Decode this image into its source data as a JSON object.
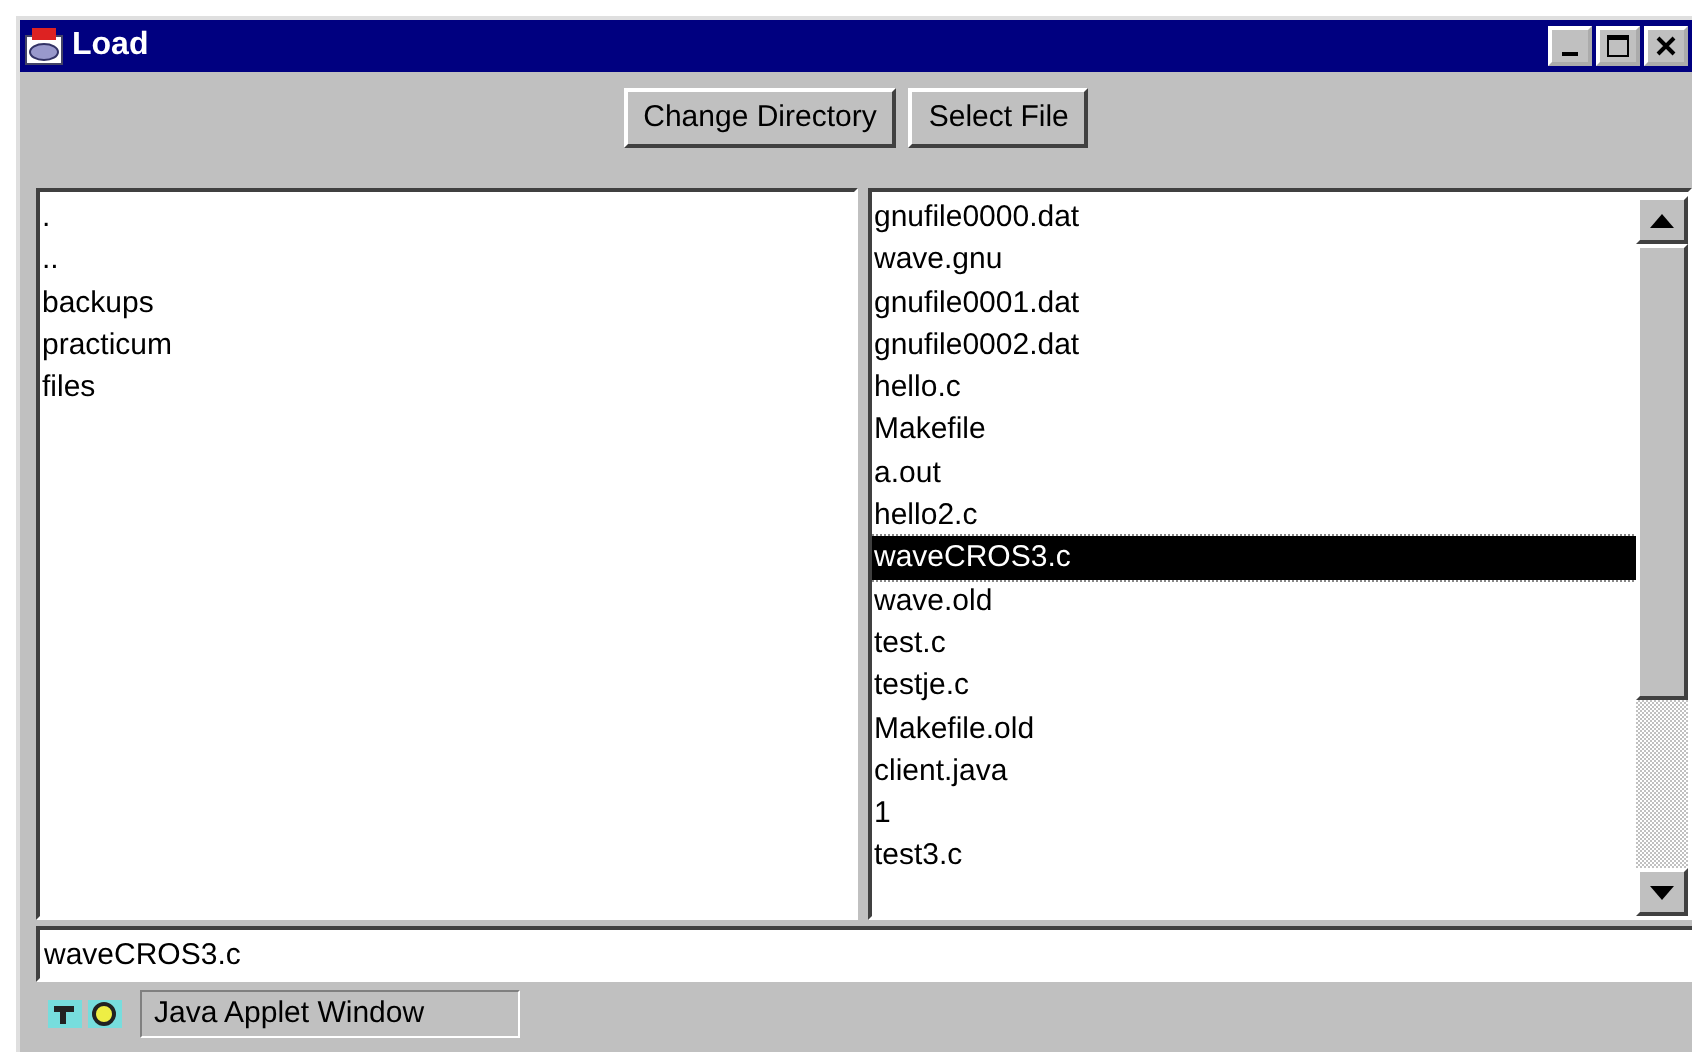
{
  "window": {
    "title": "Load"
  },
  "buttons": [
    "Change Directory",
    "Select File"
  ],
  "directories": [
    {
      "label": ".",
      "selected": false
    },
    {
      "label": "..",
      "selected": false
    },
    {
      "label": "backups",
      "selected": false
    },
    {
      "label": "practicum",
      "selected": false
    },
    {
      "label": "files",
      "selected": false
    }
  ],
  "files": [
    {
      "label": "gnufile0000.dat",
      "selected": false
    },
    {
      "label": "wave.gnu",
      "selected": false
    },
    {
      "label": "gnufile0001.dat",
      "selected": false
    },
    {
      "label": "gnufile0002.dat",
      "selected": false
    },
    {
      "label": "hello.c",
      "selected": false
    },
    {
      "label": "Makefile",
      "selected": false
    },
    {
      "label": "a.out",
      "selected": false
    },
    {
      "label": "hello2.c",
      "selected": false
    },
    {
      "label": "waveCROS3.c",
      "selected": true
    },
    {
      "label": "wave.old",
      "selected": false
    },
    {
      "label": "test.c",
      "selected": false
    },
    {
      "label": "testje.c",
      "selected": false
    },
    {
      "label": "Makefile.old",
      "selected": false
    },
    {
      "label": "client.java",
      "selected": false
    },
    {
      "label": "1",
      "selected": false
    },
    {
      "label": "test3.c",
      "selected": false
    }
  ],
  "filename_field": {
    "value": "waveCROS3.c"
  },
  "status_bar": {
    "text": "Java Applet Window"
  }
}
